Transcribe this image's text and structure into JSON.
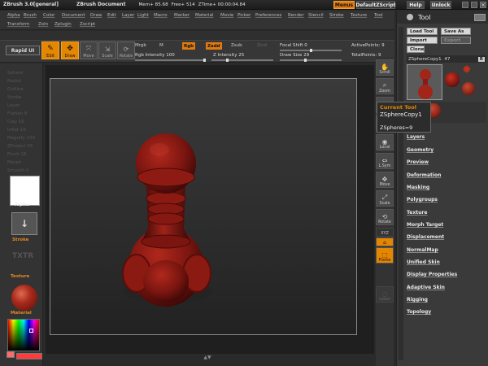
{
  "app": {
    "title": "ZBrush 3.0[general]",
    "document": "ZBrush Document",
    "mem": "Mem+ 85.68",
    "free": "Free+ 514",
    "ztime": "ZTime+ 00:00:04.84"
  },
  "titlebuttons": {
    "menus": "Menus",
    "script": "DefaultZScript",
    "help": "Help",
    "unlock": "Unlock"
  },
  "menus": {
    "row1": [
      "Alpha",
      "Brush",
      "Color",
      "Document",
      "Draw",
      "Edit",
      "Layer",
      "Light",
      "Macro",
      "Marker",
      "Material",
      "Movie",
      "Picker",
      "Preferences",
      "Render",
      "Stencil",
      "Stroke",
      "Texture",
      "Tool"
    ],
    "row2": [
      "Transform",
      "Zoin",
      "Zplugin",
      "Zscript"
    ]
  },
  "toolbar": {
    "rapid_ui": "Rapid UI",
    "edit": "Edit",
    "draw": "Draw",
    "move": "Move",
    "scale": "Scale",
    "rotate": "Rotate",
    "mrgb": "Mrgb",
    "m": "M",
    "rgb": "Rgb",
    "zadd": "Zadd",
    "zsub": "Zsub",
    "zcut": "Zcut",
    "rgb_intensity_label": "Rgb Intensity",
    "rgb_intensity_value": "100",
    "z_intensity_label": "Z Intensity",
    "z_intensity_value": "25",
    "focal_shift_label": "Focal Shift",
    "focal_shift_value": "0",
    "draw_size_label": "Draw Size",
    "draw_size_value": "29",
    "active_points_label": "ActivePoints:",
    "active_points_value": "9",
    "total_points_label": "TotalPoints:",
    "total_points_value": "9"
  },
  "leftshelf": {
    "ghost_items": [
      "Sphere",
      "Radial",
      "Outline",
      "Stroke",
      "Layer",
      "Flatten 8",
      "Clay 16",
      "Inflat 16",
      "Magnify 100",
      "ZProject 56",
      "Pinch 16",
      "Morph",
      "Smooth 0"
    ],
    "alpha": "Alpha",
    "stroke": "Stroke",
    "texture": "Texture",
    "txtr_off": "TXTR",
    "material": "Material",
    "main_color": "#ff3b3b",
    "secondary_color": "#ff6b6b"
  },
  "rightshelf": {
    "buttons": [
      "Scroll",
      "Zoom",
      "Actual",
      "AAHalf",
      "Local",
      "L.Sym",
      "Move",
      "Scale",
      "Rotate",
      "XYZ",
      "",
      "Frame",
      "Lasso"
    ]
  },
  "tooltip": {
    "title": "Current Tool",
    "name": "ZSphereCopy1",
    "info": "ZSpheres=9"
  },
  "toolpanel": {
    "title": "Tool",
    "load_tool": "Load Tool",
    "save_as": "Save As",
    "import": "Import",
    "export": "Export",
    "clone": "Clone",
    "current_name": "ZSphereCopy1.",
    "current_count": "47",
    "r_button": "R",
    "items": [
      "Layers",
      "Geometry",
      "Preview",
      "Deformation",
      "Masking",
      "Polygroups",
      "Texture",
      "Morph Target",
      "Displacement",
      "NormalMap",
      "Unified Skin",
      "Display Properties",
      "Adaptive Skin",
      "Rigging",
      "Topology"
    ]
  },
  "colors": {
    "accent": "#e58600",
    "model": "#8a1a14"
  }
}
